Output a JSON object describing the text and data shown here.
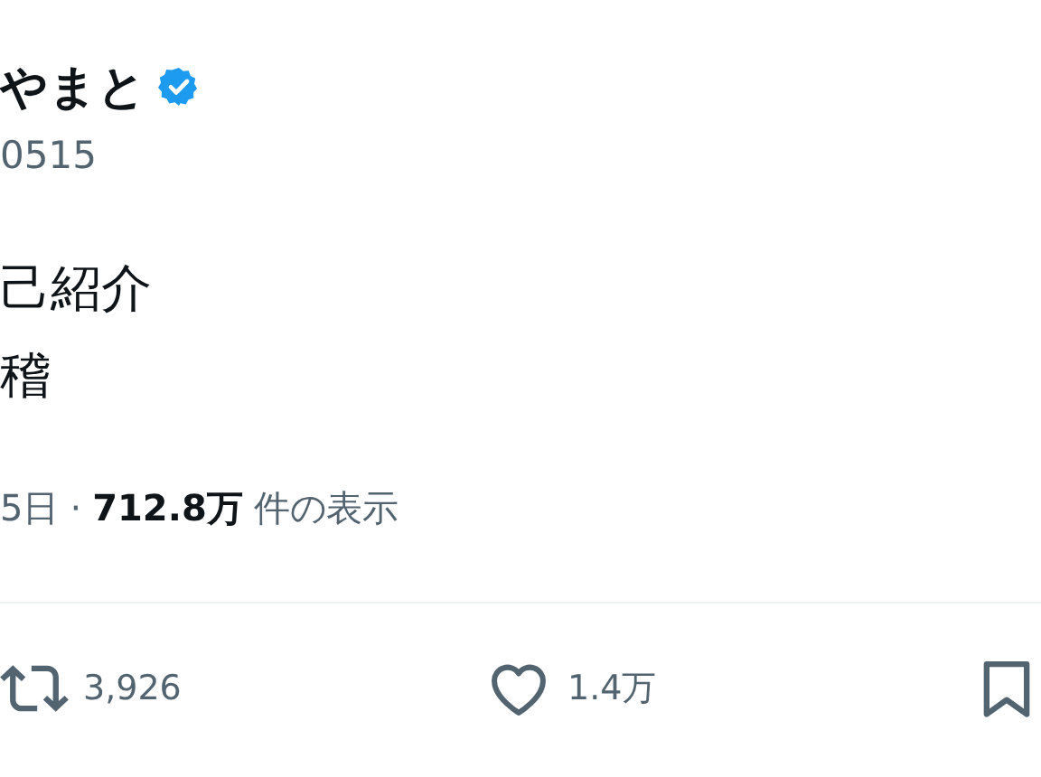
{
  "author": {
    "name": "やまと",
    "verified": true,
    "handle": "0515"
  },
  "post": {
    "lines": [
      "己紹介",
      "稽"
    ]
  },
  "meta": {
    "date": "5日",
    "separator": "·",
    "views": "712.8万",
    "views_label": "件の表示"
  },
  "actions": [
    {
      "kind": "repost",
      "count": "3,926"
    },
    {
      "kind": "like",
      "count": "1.4万"
    },
    {
      "kind": "bookmark"
    }
  ]
}
